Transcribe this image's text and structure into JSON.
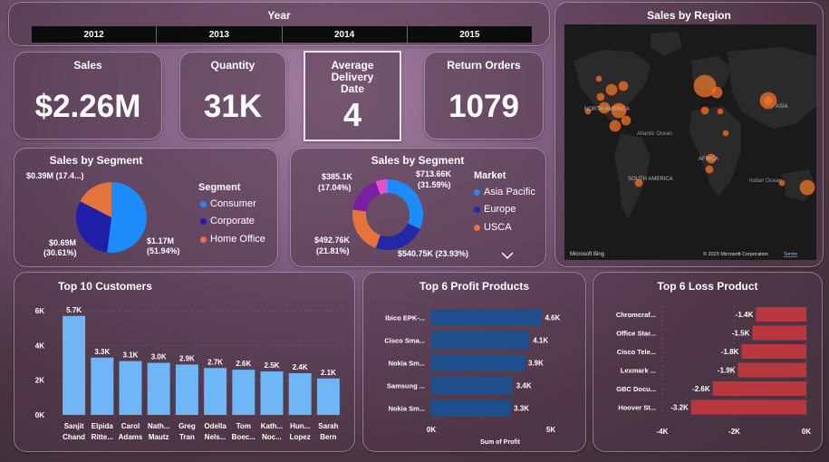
{
  "colors": {
    "bar_blue": "#6fb6f7",
    "bar_navy": "#1f4e8c",
    "bar_red": "#b9373f",
    "consumer": "#1d8cf8",
    "corporate": "#1f1fa8",
    "home_office": "#e4743b",
    "asia_pacific": "#1d8cf8",
    "europe": "#2427a6",
    "usca": "#e4743b",
    "extra1": "#7b1fa2",
    "extra2": "#e056c8"
  },
  "year_slicer": {
    "title": "Year",
    "years": [
      "2012",
      "2013",
      "2014",
      "2015"
    ]
  },
  "kpis": {
    "sales": {
      "label": "Sales",
      "value": "$2.26M"
    },
    "quantity": {
      "label": "Quantity",
      "value": "31K"
    },
    "delivery": {
      "label": "Average Delivery Date",
      "value": "4"
    },
    "returns": {
      "label": "Return Orders",
      "value": "1079"
    }
  },
  "segment_pie": {
    "title": "Sales by Segment",
    "legend_title": "Segment",
    "legend": [
      "Consumer",
      "Corporate",
      "Home Office"
    ],
    "labels": {
      "consumer": [
        "$1.17M",
        "(51.94%)"
      ],
      "corporate": [
        "$0.69M",
        "(30.61%)"
      ],
      "home_office": [
        "$0.39M (17.4...)"
      ]
    }
  },
  "market_donut": {
    "title": "Sales by Segment",
    "legend_title": "Market",
    "legend": [
      "Asia Pacific",
      "Europe",
      "USCA"
    ],
    "labels": {
      "asia": [
        "$713.66K",
        "(31.59%)"
      ],
      "europe": [
        "$540.75K (23.93%)"
      ],
      "usca": [
        "$492.76K",
        "(21.81%)"
      ],
      "other": [
        "$385.1K",
        "(17.04%)"
      ]
    }
  },
  "map": {
    "title": "Sales by Region",
    "labels": {
      "north_america": "NORTH AMERICA",
      "atlantic": "Atlantic Ocean",
      "africa": "AFRICA",
      "south_america": "SOUTH AMERICA",
      "asia": "ASIA",
      "indian": "Indian Ocean"
    },
    "bing": "Microsoft Bing",
    "copyright": "© 2023 Microsoft Corporation",
    "terms": "Terms"
  },
  "chart_data": [
    {
      "type": "bar",
      "title": "Top 10 Customers",
      "categories": [
        [
          "Sanjit",
          "Chand"
        ],
        [
          "Elpida",
          "Ritte..."
        ],
        [
          "Carol",
          "Adams"
        ],
        [
          "Nath...",
          "Mautz"
        ],
        [
          "Greg",
          "Tran"
        ],
        [
          "Odella",
          "Nels..."
        ],
        [
          "Tom",
          "Boec..."
        ],
        [
          "Kath...",
          "Noc..."
        ],
        [
          "Hun...",
          "Lopez"
        ],
        [
          "Sarah",
          "Bern"
        ]
      ],
      "values": [
        5.7,
        3.3,
        3.1,
        3.0,
        2.9,
        2.7,
        2.6,
        2.5,
        2.4,
        2.1
      ],
      "value_labels": [
        "5.7K",
        "3.3K",
        "3.1K",
        "3.0K",
        "2.9K",
        "2.7K",
        "2.6K",
        "2.5K",
        "2.4K",
        "2.1K"
      ],
      "yticks": [
        "0K",
        "2K",
        "4K",
        "6K"
      ],
      "ylim": [
        0,
        6
      ]
    },
    {
      "type": "bar",
      "title": "Top 6 Profit Products",
      "categories": [
        "Ibico EPK-...",
        "Cisco Sma...",
        "Nokia Sm...",
        "Samsung ...",
        "Nokia Sm..."
      ],
      "values": [
        4.6,
        4.1,
        3.9,
        3.4,
        3.3
      ],
      "value_labels": [
        "4.6K",
        "4.1K",
        "3.9K",
        "3.4K",
        "3.3K"
      ],
      "xticks": [
        "0K",
        "5K"
      ],
      "xlabel": "Sum of Profit",
      "xlim": [
        0,
        5
      ]
    },
    {
      "type": "bar",
      "title": "Top 6 Loss Product",
      "categories": [
        "Chromcraf...",
        "Office Star...",
        "Cisco Tele...",
        "Lexmark ...",
        "GBC Docu...",
        "Hoover St..."
      ],
      "values": [
        -1.4,
        -1.5,
        -1.8,
        -1.9,
        -2.6,
        -3.2
      ],
      "value_labels": [
        "-1.4K",
        "-1.5K",
        "-1.8K",
        "-1.9K",
        "-2.6K",
        "-3.2K"
      ],
      "xticks": [
        "-4K",
        "-2K",
        "0K"
      ],
      "xlim": [
        -4,
        0
      ]
    },
    {
      "type": "pie",
      "title": "Sales by Segment",
      "categories": [
        "Consumer",
        "Corporate",
        "Home Office"
      ],
      "values": [
        51.94,
        30.61,
        17.4
      ]
    },
    {
      "type": "pie",
      "title": "Sales by Segment",
      "categories": [
        "Asia Pacific",
        "Europe",
        "USCA",
        "",
        ""
      ],
      "values": [
        31.59,
        23.93,
        21.81,
        17.04,
        5.63
      ]
    }
  ]
}
